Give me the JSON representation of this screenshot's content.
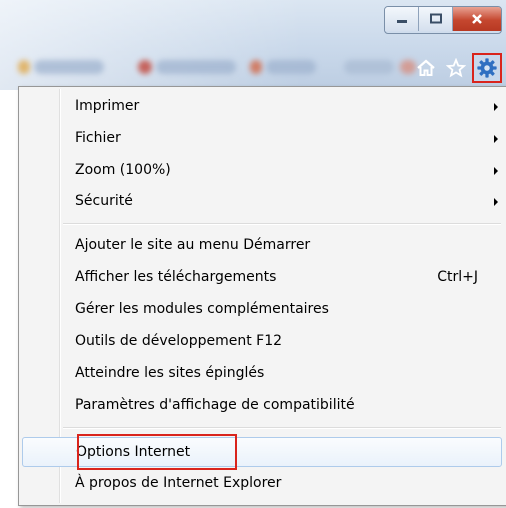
{
  "window": {
    "minimize_icon": "minimize-icon",
    "maximize_icon": "maximize-icon",
    "close_icon": "close-icon"
  },
  "toolbar": {
    "icons": [
      "home-icon",
      "star-icon",
      "gear-icon"
    ]
  },
  "menu": {
    "group1": [
      {
        "label": "Imprimer",
        "submenu": true
      },
      {
        "label": "Fichier",
        "submenu": true
      },
      {
        "label": "Zoom (100%)",
        "submenu": true
      },
      {
        "label": "Sécurité",
        "submenu": true
      }
    ],
    "group2": [
      {
        "label": "Ajouter le site au menu Démarrer"
      },
      {
        "label": "Afficher les téléchargements",
        "shortcut": "Ctrl+J"
      },
      {
        "label": "Gérer les modules complémentaires"
      },
      {
        "label": "Outils de développement F12"
      },
      {
        "label": "Atteindre les sites épinglés"
      },
      {
        "label": "Paramètres d'affichage de compatibilité"
      }
    ],
    "group3": [
      {
        "label": "Options Internet",
        "highlighted": true
      },
      {
        "label": "À propos de Internet Explorer"
      }
    ]
  },
  "colors": {
    "highlight_outline": "#d9241c",
    "gear_blue": "#2f6fc1"
  }
}
